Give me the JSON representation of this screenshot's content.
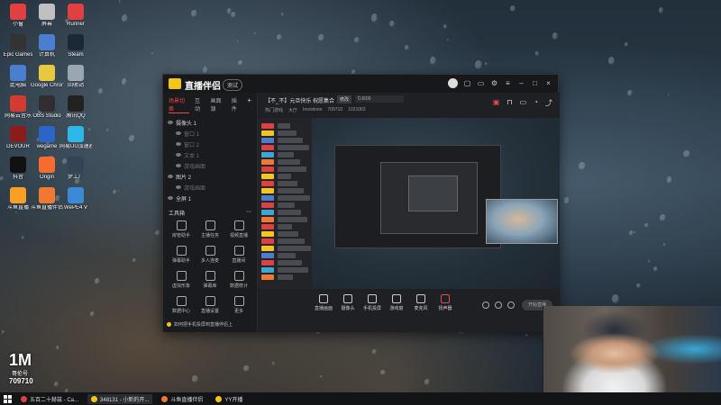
{
  "window": {
    "app_name": "直播伴侣",
    "version_badge": "测试"
  },
  "scene_tabs": [
    "场景切换",
    "互动",
    "画面源",
    "插件"
  ],
  "scenes": [
    {
      "label": "摄像头 1",
      "dim": false,
      "indent": false
    },
    {
      "label": "窗口 1",
      "dim": true,
      "indent": true
    },
    {
      "label": "窗口 2",
      "dim": true,
      "indent": true
    },
    {
      "label": "文本 1",
      "dim": true,
      "indent": true
    },
    {
      "label": "游戏画面",
      "dim": true,
      "indent": true
    },
    {
      "label": "图片 2",
      "dim": false,
      "indent": false
    },
    {
      "label": "游戏画面",
      "dim": true,
      "indent": true
    },
    {
      "label": "全屏 1",
      "dim": false,
      "indent": false
    }
  ],
  "tools": {
    "title": "工具箱",
    "items": [
      "房管助手",
      "主播任务",
      "视频直播",
      "弹幕助手",
      "多人连麦",
      "直播间",
      "虚拟形象",
      "弹幕库",
      "数据统计",
      "数据中心",
      "直播设置",
      "更多"
    ]
  },
  "tip": "如何把手机投屏到直播伴侣上",
  "header": {
    "room_title": "【不_不】元旦快乐 祝愿集合",
    "edit_label": "修改",
    "room_field": "DJ600",
    "meta": [
      "热门游戏",
      "大厅",
      "Imosiiono",
      "709710",
      "1021063"
    ]
  },
  "controls": [
    "直播画面",
    "摄像头",
    "手机投屏",
    "游戏窗",
    "麦克风",
    "扬声器"
  ],
  "start_button": "开始直播",
  "desktop_icons": [
    {
      "label": "小窗",
      "color": "#e04040"
    },
    {
      "label": "屏幕",
      "color": "#c0c0c0"
    },
    {
      "label": "Runner",
      "color": "#e04040"
    },
    {
      "label": "Epic Games",
      "color": "#333333"
    },
    {
      "label": "计算机",
      "color": "#4a7fd0"
    },
    {
      "label": "Steam",
      "color": "#1b2838"
    },
    {
      "label": "此电脑",
      "color": "#4a7fd0"
    },
    {
      "label": "Google Chrome",
      "color": "#e8c840"
    },
    {
      "label": "回收站",
      "color": "#9aa7b0"
    },
    {
      "label": "网易云音乐",
      "color": "#d33a31"
    },
    {
      "label": "OBS Studio",
      "color": "#302e31"
    },
    {
      "label": "腾讯QQ",
      "color": "#222222"
    },
    {
      "label": "DEVOUR",
      "color": "#8a1c1c"
    },
    {
      "label": "wegame",
      "color": "#2a66c8"
    },
    {
      "label": "网易UU加速器",
      "color": "#2eb8e8"
    },
    {
      "label": "抖音",
      "color": "#111111"
    },
    {
      "label": "Origin",
      "color": "#f56c2d"
    },
    {
      "label": "梦工厂",
      "color": "#334455"
    },
    {
      "label": "斗鱼直播",
      "color": "#f7a024"
    },
    {
      "label": "斗鱼直播伴侣",
      "color": "#f07830"
    },
    {
      "label": "WePE4 V",
      "color": "#3a8ad8"
    }
  ],
  "brand_logo": {
    "big": "1M",
    "sub": "哥伦号",
    "num": "709710"
  },
  "taskbar": {
    "items": [
      {
        "label": "五百二十赫兹 - Ca...",
        "color": "#e04040",
        "active": false
      },
      {
        "label": "348131 - 小新的开...",
        "color": "#f5c518",
        "active": true
      },
      {
        "label": "斗鱼直播伴侣",
        "color": "#f07830",
        "active": false
      },
      {
        "label": "YY开播",
        "color": "#f5c518",
        "active": false
      }
    ]
  }
}
